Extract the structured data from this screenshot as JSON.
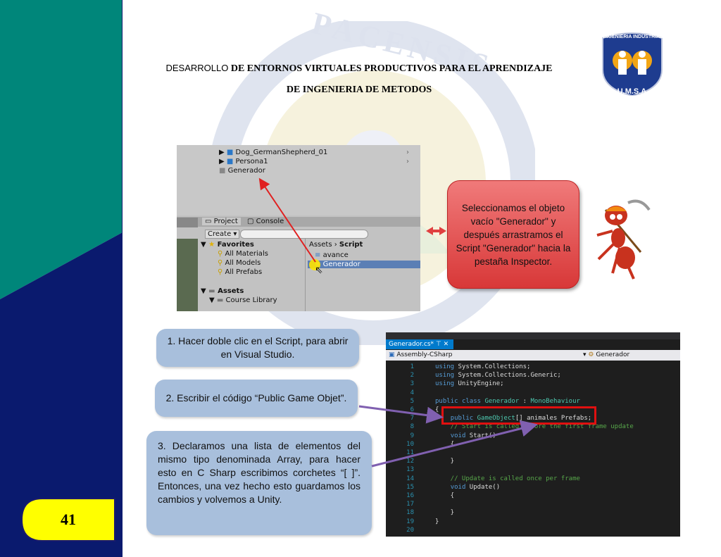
{
  "header": {
    "line1_lead": "DESARROLLO",
    "line1_bold": "DE ENTORNOS VIRTUALES PRODUCTIVOS PARA EL APRENDIZAJE",
    "line2": "DE INGENIERIA DE METODOS"
  },
  "watermark": {
    "text": "PACENSIS"
  },
  "logo": {
    "top_text": "INGENIERIA INDUSTRIAL",
    "bottom_text": "U.M.S.A."
  },
  "unity": {
    "hierarchy": [
      "Dog_GermanShepherd_01",
      "Persona1",
      "Generador"
    ],
    "tabs": {
      "project": "Project",
      "console": "Console",
      "create": "Create"
    },
    "favorites": {
      "label": "Favorites",
      "items": [
        "All Materials",
        "All Models",
        "All Prefabs"
      ]
    },
    "assets": {
      "label": "Assets",
      "items": [
        "Course Library"
      ]
    },
    "breadcrumb": {
      "root": "Assets",
      "current": "Script"
    },
    "files": [
      "avance",
      "Generador"
    ]
  },
  "callout_red": {
    "text": "Seleccionamos el objeto vacío \"Generador\" y después arrastramos el Script \"Generador\" hacia la pestaña Inspector."
  },
  "steps": [
    {
      "text": "1. Hacer doble clic en el Script, para abrir en Visual Studio."
    },
    {
      "text": "2. Escribir el código “Public Game Objet”."
    },
    {
      "text": "3. Declaramos una lista de elementos del mismo tipo denominada Array, para hacer esto en C Sharp escribimos corchetes “[ ]”. Entonces, una vez hecho esto guardamos los cambios y volvemos a Unity."
    }
  ],
  "code_editor": {
    "tab": "Generador.cs*",
    "project": "Assembly-CSharp",
    "member": "Generador",
    "lines": [
      "using System.Collections;",
      "using System.Collections.Generic;",
      "using UnityEngine;",
      "",
      "public class Generador : MonoBehaviour",
      "{",
      "    public GameObject[] animales Prefabs;",
      "    // Start is called before the first frame update",
      "    void Start()",
      "    {",
      "",
      "    }",
      "",
      "    // Update is called once per frame",
      "    void Update()",
      "    {",
      "",
      "    }",
      "}",
      ""
    ]
  },
  "page_number": "41",
  "colors": {
    "teal": "#00867a",
    "navy": "#0a1a6e",
    "yellow": "#ffff00",
    "red_callout": "#e05252",
    "blue_box": "#a8bfdc",
    "purple_arrow": "#8060b0"
  }
}
